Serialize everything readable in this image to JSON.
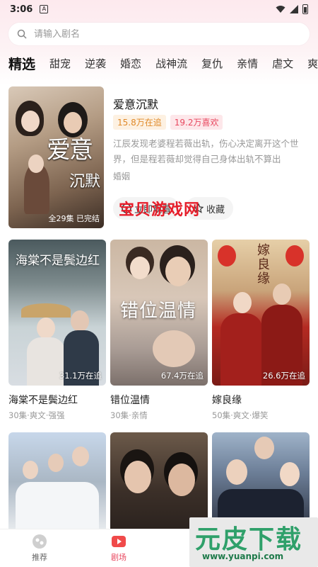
{
  "status_bar": {
    "time": "3:06",
    "notification_letter": "A"
  },
  "search": {
    "placeholder": "请输入剧名"
  },
  "tabs": [
    {
      "label": "精选",
      "active": true
    },
    {
      "label": "甜宠"
    },
    {
      "label": "逆袭"
    },
    {
      "label": "婚恋"
    },
    {
      "label": "战神流"
    },
    {
      "label": "复仇"
    },
    {
      "label": "亲情"
    },
    {
      "label": "虐文"
    },
    {
      "label": "爽文"
    }
  ],
  "featured": {
    "title": "爱意沉默",
    "poster_title": "爱意",
    "poster_title2": "沉默",
    "tag_follow": "15.8万在追",
    "tag_like": "19.2万喜欢",
    "description": "江辰发现老婆程若薇出轨，伤心决定离开这个世界，但是程若薇却觉得自己身体出轨不算出轨，...",
    "genre": "婚姻",
    "episodes": "全29集 已完结",
    "watch_label": "立即观看",
    "collect_label": "收藏"
  },
  "watermark": "宝贝游戏网",
  "cards": [
    {
      "name": "海棠不是鬓边红",
      "sub": "30集·爽文·强强",
      "views": "31.1万在追",
      "poster_text": "海棠不是鬓边红"
    },
    {
      "name": "错位温情",
      "sub": "30集·亲情",
      "views": "67.4万在追",
      "poster_text": "错位温情"
    },
    {
      "name": "嫁良缘",
      "sub": "50集·爽文·爆笑",
      "views": "26.6万在追",
      "poster_text": "嫁良缘"
    }
  ],
  "bottom_nav": [
    {
      "label": "推荐",
      "icon": "recommend-icon"
    },
    {
      "label": "剧场",
      "icon": "theater-icon",
      "active": true
    }
  ],
  "overlay_logo": {
    "title": "元皮下载",
    "url": "www.yuanpi.com"
  },
  "colors": {
    "accent": "#e8485f",
    "orange": "#e08a2a",
    "watermark_red": "#e61e2b",
    "logo_green": "#2fa06a"
  }
}
